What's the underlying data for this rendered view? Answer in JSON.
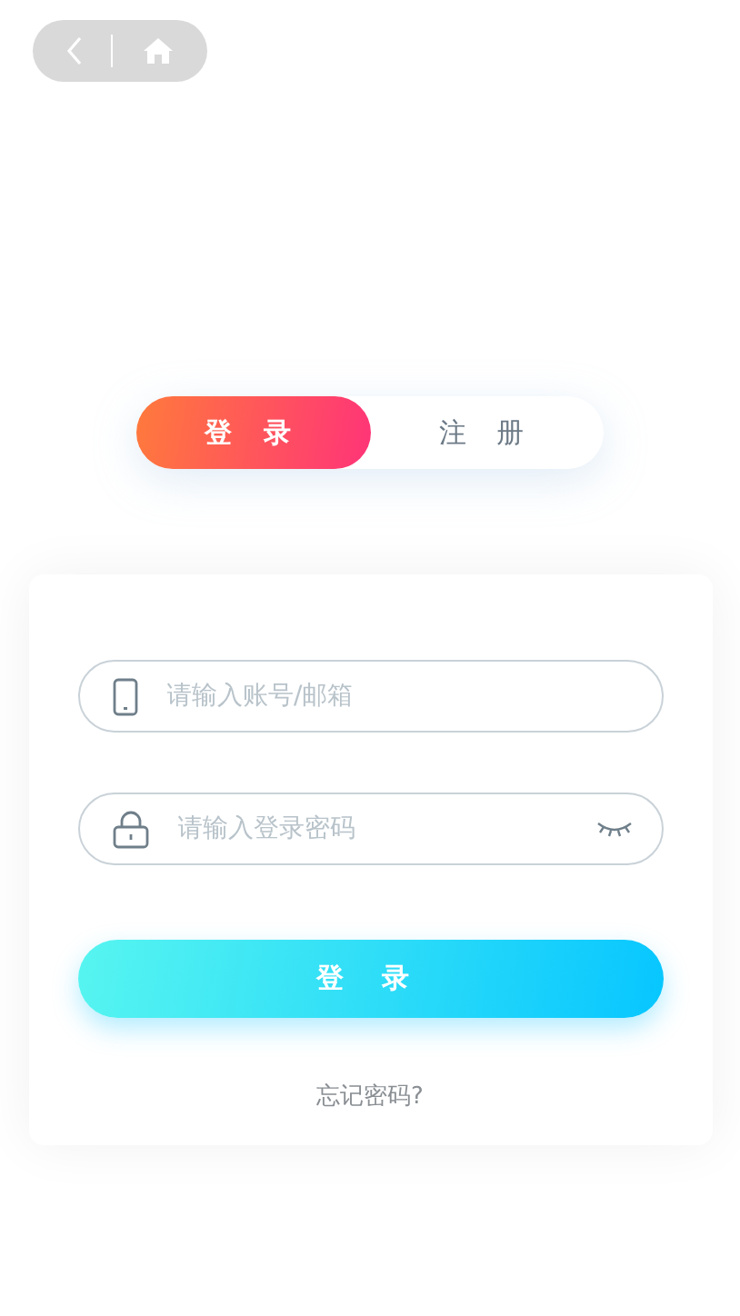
{
  "tabs": [
    {
      "label": "登 录",
      "selected": true
    },
    {
      "label": "注 册",
      "selected": false
    }
  ],
  "account_field": {
    "placeholder": "请输入账号/邮箱"
  },
  "password_field": {
    "placeholder": "请输入登录密码"
  },
  "login_button": "登 录",
  "forgot_link": "忘记密码?"
}
